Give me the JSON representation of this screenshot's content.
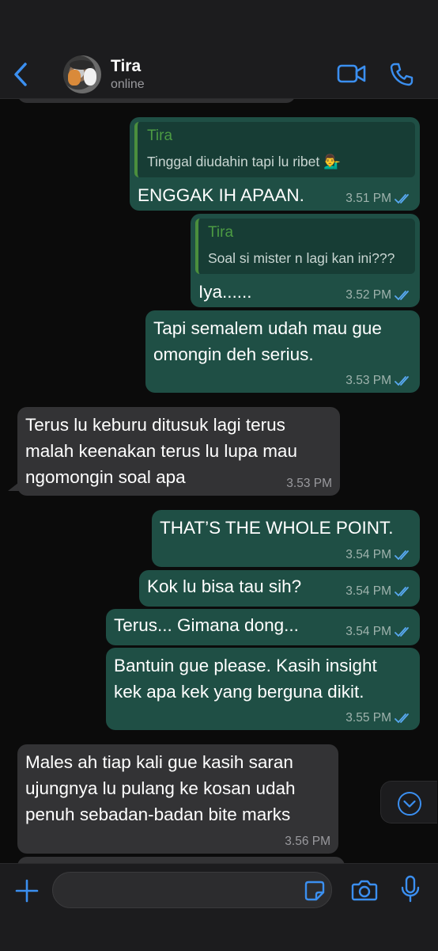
{
  "header": {
    "contact_name": "Tira",
    "status": "online"
  },
  "messages": [
    {
      "dir": "out",
      "quote_name": "Tira",
      "quote_text": "Tinggal diudahin tapi lu ribet 💁‍♂️",
      "text": "ENGGAK IH APAAN.",
      "time": "3.51 PM"
    },
    {
      "dir": "out",
      "quote_name": "Tira",
      "quote_text": "Soal si mister n lagi kan ini???",
      "text": "Iya......",
      "time": "3.52 PM"
    },
    {
      "dir": "out",
      "text_lines": [
        "Tapi semalem udah mau gue",
        "omongin deh serius."
      ],
      "time": "3.53 PM"
    },
    {
      "dir": "in",
      "text_lines": [
        "Terus lu keburu ditusuk lagi terus",
        "malah keenakan terus lu lupa mau",
        "ngomongin soal apa"
      ],
      "time": "3.53 PM"
    },
    {
      "dir": "out",
      "text": "THAT’S THE WHOLE POINT.",
      "time": "3.54 PM"
    },
    {
      "dir": "out",
      "text": "Kok lu bisa tau sih?",
      "time": "3.54 PM"
    },
    {
      "dir": "out",
      "text": "Terus... Gimana dong...",
      "time": "3.54 PM"
    },
    {
      "dir": "out",
      "text_lines": [
        "Bantuin gue please. Kasih insight",
        "kek apa kek yang berguna dikit."
      ],
      "time": "3.55 PM"
    },
    {
      "dir": "in",
      "text_lines": [
        "Males ah tiap kali gue kasih saran",
        "ujungnya lu pulang ke kosan udah",
        "penuh sebadan-badan bite marks"
      ],
      "time": "3.56 PM"
    }
  ],
  "input": {
    "placeholder": ""
  },
  "colors": {
    "outgoing_bubble": "#1f4f45",
    "incoming_bubble": "#333335",
    "accent_blue": "#3b8ff0",
    "read_ticks": "#58a8f0",
    "quote_name": "#4c9b43"
  },
  "icons": [
    "back-chevron-icon",
    "video-call-icon",
    "phone-icon",
    "double-check-icon",
    "chevron-down-icon",
    "plus-icon",
    "sticker-icon",
    "camera-icon",
    "microphone-icon"
  ]
}
